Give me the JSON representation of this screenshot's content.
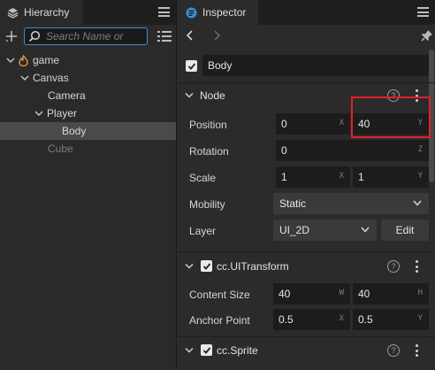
{
  "hierarchy": {
    "tab_label": "Hierarchy",
    "search_placeholder": "Search Name or",
    "tree": [
      {
        "label": "game",
        "depth": 0,
        "expanded": true,
        "icon": "fire-icon"
      },
      {
        "label": "Canvas",
        "depth": 1,
        "expanded": true
      },
      {
        "label": "Camera",
        "depth": 2
      },
      {
        "label": "Player",
        "depth": 2,
        "expanded": true
      },
      {
        "label": "Body",
        "depth": 3,
        "selected": true
      },
      {
        "label": "Cube",
        "depth": 2,
        "dim": true
      }
    ]
  },
  "inspector": {
    "tab_label": "Inspector",
    "node_name": "Body",
    "node_section": {
      "title": "Node",
      "position": {
        "label": "Position",
        "x": "0",
        "x_axis": "X",
        "y": "40",
        "y_axis": "Y"
      },
      "rotation": {
        "label": "Rotation",
        "z": "0",
        "z_axis": "Z"
      },
      "scale": {
        "label": "Scale",
        "x": "1",
        "x_axis": "X",
        "y": "1",
        "y_axis": "Y"
      },
      "mobility": {
        "label": "Mobility",
        "value": "Static"
      },
      "layer": {
        "label": "Layer",
        "value": "UI_2D",
        "edit_label": "Edit"
      }
    },
    "uitransform": {
      "title": "cc.UITransform",
      "content_size": {
        "label": "Content Size",
        "w": "40",
        "w_axis": "W",
        "h": "40",
        "h_axis": "H"
      },
      "anchor_point": {
        "label": "Anchor Point",
        "x": "0.5",
        "x_axis": "X",
        "y": "0.5",
        "y_axis": "Y"
      }
    },
    "sprite": {
      "title": "cc.Sprite"
    },
    "help_glyph": "?"
  },
  "colors": {
    "accent": "#3b8fd9",
    "highlight": "#e0202a",
    "selected_row": "#4a4a4a"
  }
}
